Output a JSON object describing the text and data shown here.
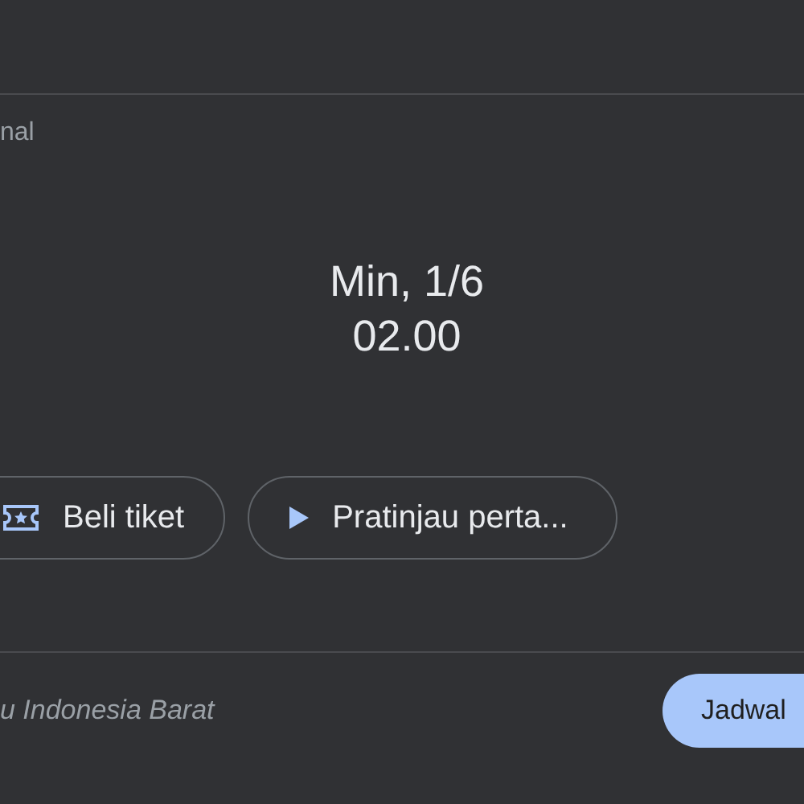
{
  "section_label": "nal",
  "event": {
    "date": "Min, 1/6",
    "time": "02.00"
  },
  "actions": [
    {
      "kind": "ticket",
      "label": "Beli tiket"
    },
    {
      "kind": "preview",
      "label": "Pratinjau perta..."
    }
  ],
  "footer": {
    "timezone_note": "u Indonesia Barat",
    "button": "Jadwal"
  }
}
